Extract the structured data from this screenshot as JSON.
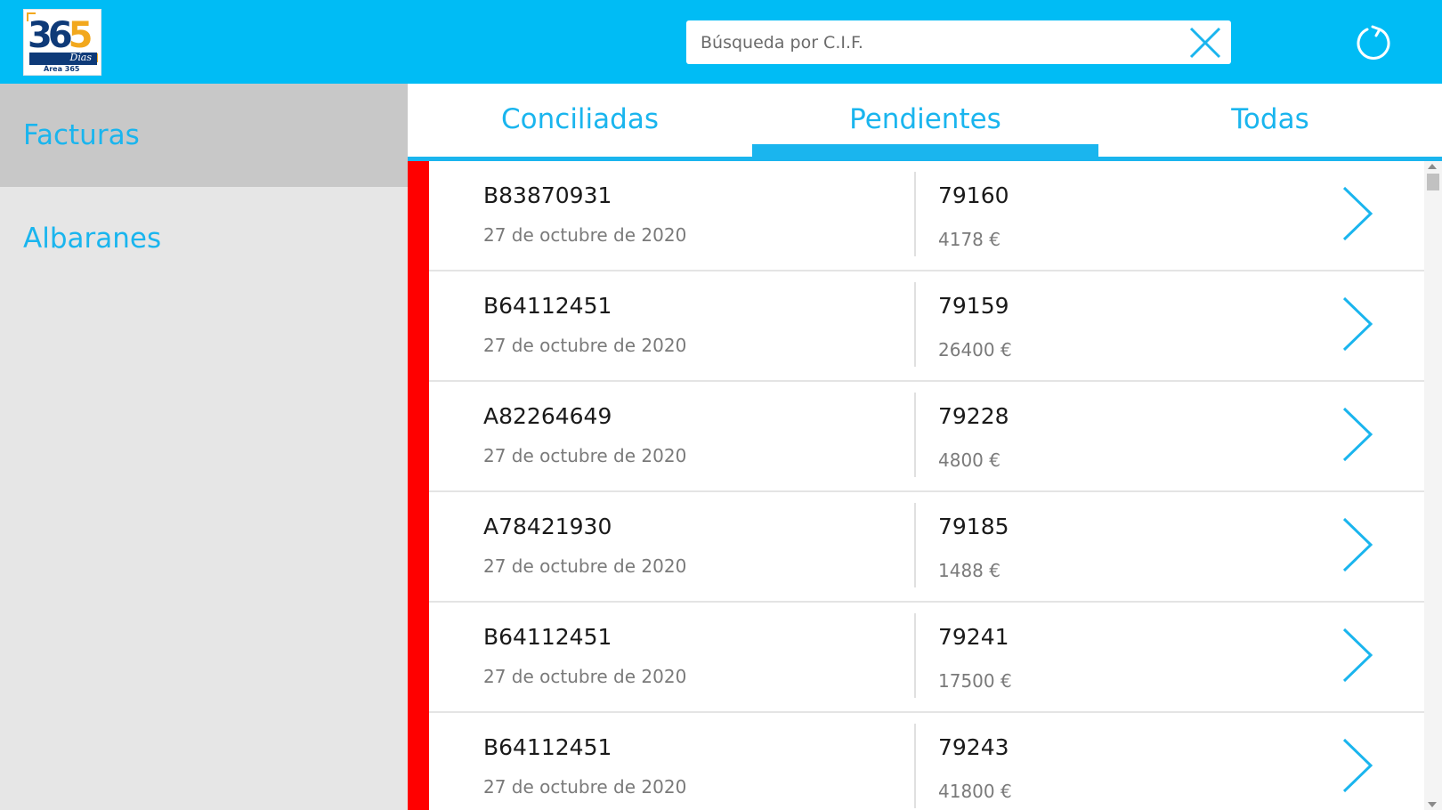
{
  "header": {
    "logo": {
      "number": "365",
      "script": "Días",
      "brand": "Área 365"
    },
    "search": {
      "placeholder": "Búsqueda por C.I.F.",
      "value": ""
    },
    "icons": {
      "clear": "close-icon",
      "refresh": "refresh-icon"
    }
  },
  "sidebar": {
    "items": [
      {
        "label": "Facturas",
        "active": true
      },
      {
        "label": "Albaranes",
        "active": false
      }
    ]
  },
  "tabs": [
    {
      "label": "Conciliadas",
      "active": false
    },
    {
      "label": "Pendientes",
      "active": true
    },
    {
      "label": "Todas",
      "active": false
    }
  ],
  "invoices": [
    {
      "cif": "B83870931",
      "date": "27 de octubre de 2020",
      "number": "79160",
      "amount": "4178 €"
    },
    {
      "cif": "B64112451",
      "date": "27 de octubre de 2020",
      "number": "79159",
      "amount": "26400 €"
    },
    {
      "cif": "A82264649",
      "date": "27 de octubre de 2020",
      "number": "79228",
      "amount": "4800 €"
    },
    {
      "cif": "A78421930",
      "date": "27 de octubre de 2020",
      "number": "79185",
      "amount": "1488 €"
    },
    {
      "cif": "B64112451",
      "date": "27 de octubre de 2020",
      "number": "79241",
      "amount": "17500 €"
    },
    {
      "cif": "B64112451",
      "date": "27 de octubre de 2020",
      "number": "79243",
      "amount": "41800 €"
    }
  ],
  "colors": {
    "accent": "#1ab5ee",
    "header": "#00bcf5",
    "pending_flag": "#ff0000",
    "sidebar": "#e6e6e6",
    "sidebar_active": "#c8c8c8"
  }
}
